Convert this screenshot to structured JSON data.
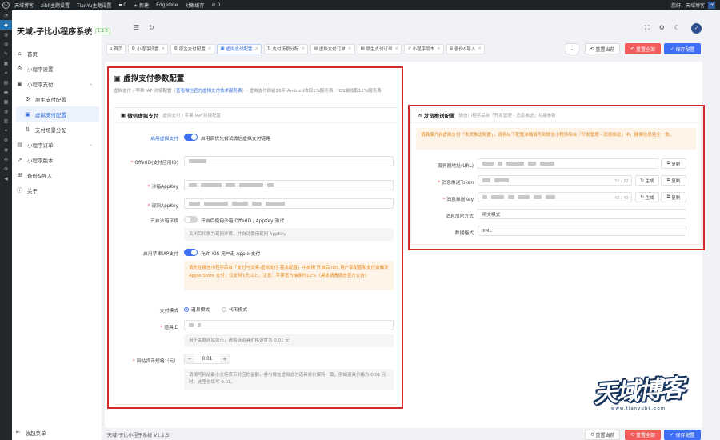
{
  "wp_bar": {
    "items": [
      "天域博客",
      "zibll主题设置",
      "TianYu主题设置",
      "0",
      "+ 新建",
      "EdgeOne",
      "对象缓存",
      "0"
    ],
    "user": "您好，天域博客",
    "avatar": "tY"
  },
  "app": {
    "title": "天域-子比小程序系统",
    "version": "1.1.5",
    "version_footer": "天域-子比小程序系统 V1.1.5"
  },
  "nav": {
    "items": [
      {
        "label": "首页",
        "icon": "home-icon"
      },
      {
        "label": "小程序设置",
        "icon": "settings-icon"
      },
      {
        "label": "小程序支付",
        "icon": "pay-icon",
        "expanded": true
      },
      {
        "label": "原生支付配置",
        "icon": "gear-icon",
        "sub": true
      },
      {
        "label": "虚拟支付配置",
        "icon": "wallet-icon",
        "sub": true,
        "active": true
      },
      {
        "label": "支付场景分配",
        "icon": "split-icon",
        "sub": true
      },
      {
        "label": "小程序订单",
        "icon": "order-icon"
      },
      {
        "label": "小程序版本",
        "icon": "version-icon"
      },
      {
        "label": "备份&导入",
        "icon": "backup-icon"
      },
      {
        "label": "关于",
        "icon": "info-icon"
      }
    ],
    "collapse_label": "收起菜单"
  },
  "tabs": [
    {
      "label": "首页",
      "icon": "⌂"
    },
    {
      "label": "小程序设置",
      "icon": "⚙"
    },
    {
      "label": "原生支付配置",
      "icon": "⚙"
    },
    {
      "label": "虚拟支付配置",
      "icon": "▣",
      "active": true
    },
    {
      "label": "支付场景分配",
      "icon": "⇅"
    },
    {
      "label": "虚拟支付订单",
      "icon": "▤"
    },
    {
      "label": "原生支付订单",
      "icon": "▤"
    },
    {
      "label": "小程序版本",
      "icon": "↗"
    },
    {
      "label": "备份&导入",
      "icon": "⊞"
    }
  ],
  "toolbar": {
    "dropdown": "⌄",
    "reset_current": "重置当前",
    "reset_all": "重置全部",
    "save": "保存配置"
  },
  "page": {
    "title": "虚拟支付参数配置",
    "desc_prefix": "虚拟支付 / 苹果 IAP 对接配置（",
    "desc_link": "查看微信官方虚拟支付技术服务费",
    "desc_suffix": "）: 虚拟支付目前26年 Android收取1%服务费，IOS端收取12%服务费"
  },
  "wechat_card": {
    "title": "微信虚拟支付",
    "subtitle": "虚拟支付 / 苹果 IAP 对接配置",
    "enable_label": "启用虚拟支付",
    "enable_text": "启用后优先尝试微信虚拟支付链路",
    "offerid_label": "OfferID(支付应用ID)",
    "sandbox_key_label": "沙箱AppKey",
    "live_key_label": "现网AppKey",
    "sandbox_env_label": "开启沙箱环境",
    "sandbox_env_text": "开启后使用沙箱 OfferID / AppKey 测试",
    "sandbox_hint": "关闭后切换为现网环境，并自动使用现网 AppKey",
    "apple_label": "启用苹果IAP支付",
    "apple_text": "允许 iOS 用户走 Apple 支付",
    "apple_warn": "请先在微信小程序后台「支付与交易-虚拟支付-基本配置」中启用 开启后 iOS 用户享配置和支付会触发 Apple Store 支付，仅支持1元以上，注意：苹果官方抽佣约12%（具体请看微信官方公告）",
    "pay_mode_label": "支付模式",
    "pay_mode_options": [
      "道具模式",
      "代币模式"
    ],
    "item_id_label": "道具ID",
    "item_hint": "用于关联网站货币，请将该道具价格设置为 0.01 元",
    "spec_label": "网站货币规格（元）",
    "spec_value": "0.01",
    "spec_minus": "−",
    "spec_plus": "+",
    "spec_hint": "请填写网站最小支持货币对应的金额，并与微信虚拟支付道具单价保持一致，例如道具价格为 0.01 元时，这里也填写 0.01。"
  },
  "push_card": {
    "title": "发货推送配置",
    "subtitle": "微信小程序后台「开发管理 - 消息推送」对接参数",
    "warn": "请确保开启虚拟支付「发货推送配置」，请将以下配置准确填写到微信小程序后台「开发管理 - 消息推送」中，确保信息完全一致。",
    "server_label": "服务器地址(URL)",
    "token_label": "消息推送Token",
    "token_count": "32 / 32",
    "aes_label": "消息推送Key",
    "aes_count": "43 / 43",
    "encrypt_label": "消息加密方式",
    "encrypt_value": "明文模式",
    "format_label": "数据格式",
    "format_value": "XML",
    "copy": "复制",
    "generate": "生成"
  },
  "watermark": {
    "logo": "天域博客",
    "url": "www.tianyubk.com"
  },
  "colors": {
    "accent": "#3f6ef5",
    "danger": "#f35c5c",
    "highlight_box": "#d12a2a",
    "warn": "#e6891f"
  }
}
